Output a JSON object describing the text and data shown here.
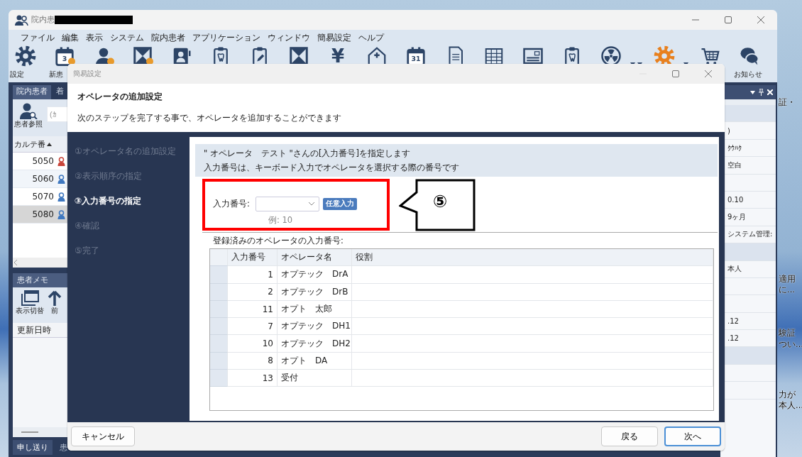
{
  "window": {
    "title": "院内患"
  },
  "menu": [
    "ファイル",
    "編集",
    "表示",
    "システム",
    "院内患者",
    "アプリケーション",
    "ウィンドウ",
    "簡易設定",
    "ヘルプ"
  ],
  "toolbar": [
    {
      "kind": "gear",
      "color": "#2c4466",
      "label": "設定",
      "badge": false
    },
    {
      "kind": "calendar",
      "number": "3",
      "label": "新患",
      "badge": true
    },
    {
      "kind": "person",
      "badge": true
    },
    {
      "kind": "bowtie",
      "badge": true
    },
    {
      "kind": "idcard",
      "badge": false
    },
    {
      "kind": "clipboard",
      "badge": false
    },
    {
      "kind": "clipboard-pen",
      "badge": false
    },
    {
      "kind": "bowtie",
      "badge": false
    },
    {
      "kind": "glyph",
      "glyph": "¥",
      "badge": false
    },
    {
      "kind": "house",
      "badge": false
    },
    {
      "kind": "calendar",
      "number": "31",
      "badge": false
    },
    {
      "kind": "document",
      "badge": false
    },
    {
      "kind": "sheet",
      "badge": false
    },
    {
      "kind": "card",
      "badge": false
    },
    {
      "kind": "clipboard",
      "badge": false
    },
    {
      "kind": "radiation",
      "badge": false
    },
    {
      "kind": "caret",
      "badge": false
    },
    {
      "kind": "caret",
      "badge": false
    },
    {
      "kind": "gear",
      "color": "#e8801e",
      "badge": false
    },
    {
      "kind": "caret",
      "badge": false
    },
    {
      "kind": "cart",
      "badge": false
    },
    {
      "kind": "chat",
      "label": "お知らせ",
      "badge": false
    }
  ],
  "patients": {
    "tabs": [
      {
        "label": "院内患者",
        "selected": true
      },
      {
        "label": "着",
        "selected": false
      }
    ],
    "search": {
      "label": "患者参照",
      "placeholder": "(ｶ"
    },
    "column": "カルテ番",
    "rows": [
      {
        "number": "5050",
        "color": "#c9453a",
        "selected": false
      },
      {
        "number": "5060",
        "color": "#3f78c0",
        "selected": false
      },
      {
        "number": "5070",
        "color": "#3f78c0",
        "selected": false
      },
      {
        "number": "5080",
        "color": "#3f78c0",
        "selected": true
      }
    ]
  },
  "memo": {
    "title": "患者メモ",
    "tools": [
      "表示切替",
      "前"
    ],
    "column": "更新日時"
  },
  "bottom_tabs": [
    {
      "label": "申し送り",
      "selected": true
    },
    {
      "label": "患",
      "selected": false
    }
  ],
  "details": [
    {
      "kind": "band"
    },
    {
      "kind": "text",
      "text": ")"
    },
    {
      "kind": "text",
      "text": "ｸｳﾊｸ"
    },
    {
      "kind": "text",
      "text": "空白"
    },
    {
      "kind": "blank"
    },
    {
      "kind": "text",
      "text": "0.10"
    },
    {
      "kind": "text",
      "text": "9ヶ月"
    },
    {
      "kind": "text",
      "text": "システム管理:"
    },
    {
      "kind": "band"
    },
    {
      "kind": "text",
      "text": "本人"
    },
    {
      "kind": "blank"
    },
    {
      "kind": "blank"
    },
    {
      "kind": "text",
      "text": ".12"
    },
    {
      "kind": "text",
      "text": ".12"
    },
    {
      "kind": "band"
    },
    {
      "kind": "blank"
    },
    {
      "kind": "blank"
    }
  ],
  "desktop_notes": [
    "証・",
    "適用",
    "に...",
    "験証",
    "つい...",
    "力が",
    "本人..."
  ],
  "dialog": {
    "title": "簡易設定",
    "heading": "オペレータの追加設定",
    "subtitle": "次のステップを完了する事で、オペレータを追加することができます",
    "steps": [
      {
        "label": "①オペレータ名の追加設定",
        "selected": false
      },
      {
        "label": "②表示順序の指定",
        "selected": false
      },
      {
        "label": "③入力番号の指定",
        "selected": true
      },
      {
        "label": "④確認",
        "selected": false
      },
      {
        "label": "⑤完了",
        "selected": false
      }
    ],
    "info": [
      "\" オペレータ　テスト \"さんの[入力番号]を指定します",
      "入力番号は、キーボード入力でオペレータを選択する際の番号です"
    ],
    "field": {
      "label": "入力番号:",
      "button": "任意入力",
      "hint": "例: 10"
    },
    "registered_label": "登録済みのオペレータの入力番号:",
    "table": {
      "columns": [
        "入力番号",
        "オペレータ名",
        "役割"
      ],
      "rows": [
        [
          "1",
          "オプテック　DrA"
        ],
        [
          "2",
          "オプテック　DrB"
        ],
        [
          "11",
          "オプト　太郎"
        ],
        [
          "7",
          "オプテック　DH1"
        ],
        [
          "10",
          "オプテック　DH2"
        ],
        [
          "8",
          "オプト　DA"
        ],
        [
          "13",
          "受付"
        ]
      ]
    },
    "buttons": [
      {
        "label": "キャンセル",
        "default": false
      },
      {
        "label": "戻る",
        "default": false
      },
      {
        "label": "次へ",
        "default": true
      }
    ]
  },
  "annotation": {
    "callout": "⑤"
  }
}
